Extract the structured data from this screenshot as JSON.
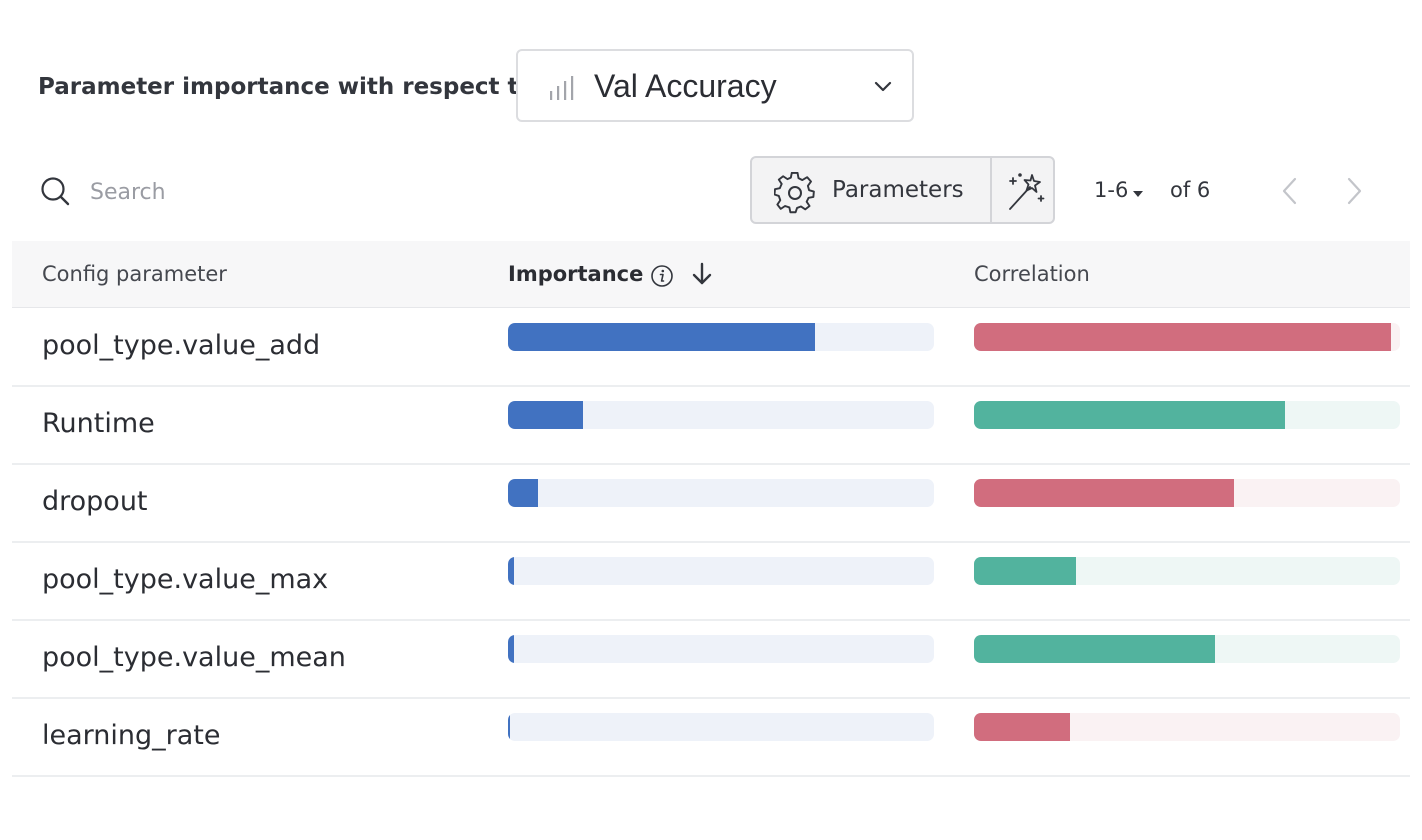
{
  "header": {
    "label": "Parameter importance with respect to",
    "metric": "Val Accuracy",
    "metric_icon": "bar-chart-icon"
  },
  "toolbar": {
    "search_placeholder": "Search",
    "parameters_label": "Parameters",
    "page_range": "1-6",
    "page_total": "of 6"
  },
  "table": {
    "columns": [
      "Config parameter",
      "Importance",
      "Correlation"
    ],
    "rows": [
      {
        "name": "pool_type.value_add",
        "importance": 0.72,
        "correlation": -0.98
      },
      {
        "name": "Runtime",
        "importance": 0.175,
        "correlation": 0.73
      },
      {
        "name": "dropout",
        "importance": 0.07,
        "correlation": -0.61
      },
      {
        "name": "pool_type.value_max",
        "importance": 0.015,
        "correlation": 0.24
      },
      {
        "name": "pool_type.value_mean",
        "importance": 0.015,
        "correlation": 0.565
      },
      {
        "name": "learning_rate",
        "importance": 0.004,
        "correlation": -0.225
      }
    ]
  },
  "colors": {
    "importance": "#4172c1",
    "positive_correlation": "#52b39e",
    "negative_correlation": "#d16d7e"
  }
}
